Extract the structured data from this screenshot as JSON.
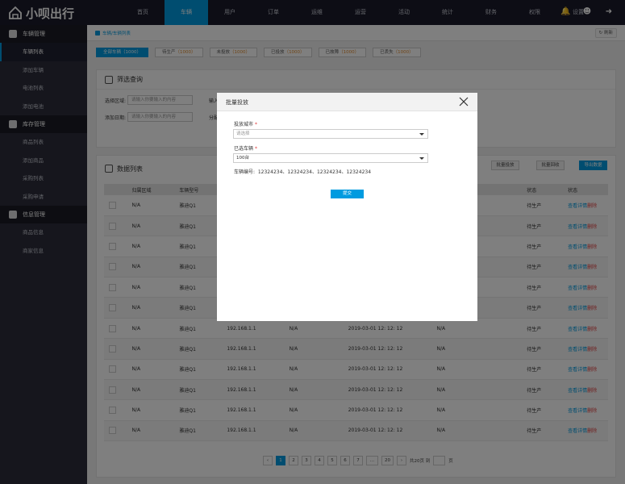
{
  "app": {
    "name": "小呗出行"
  },
  "nav": [
    "首页",
    "车辆",
    "用户",
    "订单",
    "运维",
    "运营",
    "活动",
    "统计",
    "财务",
    "权限",
    "设置"
  ],
  "nav_active": 1,
  "sidebar": {
    "groups": [
      {
        "label": "车辆管理",
        "icon": "scooter-icon",
        "items": [
          "车辆列表",
          "添加车辆",
          "电池列表",
          "添加电池"
        ]
      },
      {
        "label": "库存管理",
        "icon": "inventory-icon",
        "items": [
          "商品列表",
          "添加商品",
          "采购列表",
          "采购申请"
        ]
      },
      {
        "label": "信息管理",
        "icon": "layers-icon",
        "items": [
          "商品信息",
          "商家信息"
        ]
      }
    ],
    "active": "车辆列表"
  },
  "breadcrumb": "车辆/车辆列表",
  "refresh_label": "刷新",
  "status_tabs": [
    {
      "label": "全部车辆",
      "count": "（1000）"
    },
    {
      "label": "待生产",
      "count": "（1000）"
    },
    {
      "label": "未投放",
      "count": "（1000）"
    },
    {
      "label": "已投放",
      "count": "（1000）"
    },
    {
      "label": "已故障",
      "count": "（1000）"
    },
    {
      "label": "已丢失",
      "count": "（1000）"
    }
  ],
  "filter": {
    "title": "筛选查询",
    "region_label": "选择区域:",
    "region_placeholder": "请输入你要输入的内容",
    "date_label": "添加日期:",
    "date_placeholder": "请输入你要输入的内容",
    "input_label": "输入",
    "dist_label": "分配"
  },
  "list": {
    "title": "数据列表",
    "btn_batch_deploy": "批量投放",
    "btn_batch_recall": "批量回收",
    "btn_export": "导出数据",
    "headers": [
      "",
      "归属区域",
      "车辆型号",
      "",
      "",
      "",
      "",
      "状态",
      "状态"
    ],
    "rows": [
      [
        "N/A",
        "雅迪Q1",
        "",
        "",
        "",
        "",
        "待生产"
      ],
      [
        "N/A",
        "雅迪Q1",
        "",
        "",
        "",
        "",
        "待生产"
      ],
      [
        "N/A",
        "雅迪Q1",
        "",
        "",
        "",
        "",
        "待生产"
      ],
      [
        "N/A",
        "雅迪Q1",
        "",
        "",
        "",
        "",
        "待生产"
      ],
      [
        "N/A",
        "雅迪Q1",
        "",
        "",
        "",
        "",
        "待生产"
      ],
      [
        "N/A",
        "雅迪Q1",
        "",
        "",
        "",
        "",
        "待生产"
      ],
      [
        "N/A",
        "雅迪Q1",
        "192.168.1.1",
        "N/A",
        "2019-03-01 12:  12:  12",
        "N/A",
        "待生产"
      ],
      [
        "N/A",
        "雅迪Q1",
        "192.168.1.1",
        "N/A",
        "2019-03-01 12:  12:  12",
        "N/A",
        "待生产"
      ],
      [
        "N/A",
        "雅迪Q1",
        "192.168.1.1",
        "N/A",
        "2019-03-01 12:  12:  12",
        "N/A",
        "待生产"
      ],
      [
        "N/A",
        "雅迪Q1",
        "192.168.1.1",
        "N/A",
        "2019-03-01 12:  12:  12",
        "N/A",
        "待生产"
      ],
      [
        "N/A",
        "雅迪Q1",
        "192.168.1.1",
        "N/A",
        "2019-03-01 12:  12:  12",
        "N/A",
        "待生产"
      ],
      [
        "N/A",
        "雅迪Q1",
        "192.168.1.1",
        "N/A",
        "2019-03-01 12:  12:  12",
        "N/A",
        "待生产"
      ]
    ],
    "action_view": "查看详情",
    "action_delete": "删除"
  },
  "pager": {
    "prev": "‹",
    "pages": [
      "1",
      "2",
      "3",
      "4",
      "5",
      "6",
      "7",
      "...",
      "20"
    ],
    "next": "›",
    "total": "共20页 到",
    "page_suffix": "页",
    "current": "1"
  },
  "modal": {
    "title": "批量投放",
    "city_label": "投放城市",
    "city_placeholder": "请选择",
    "selected_label": "已选车辆",
    "selected_value": "100台",
    "ids_label": "车辆编号:",
    "ids_value": "12324234、12324234、12324234、12324234",
    "required_mark": "*",
    "submit_label": "提交"
  },
  "colors": {
    "accent": "#009be0",
    "topbar": "#1a1b2a",
    "sidebar": "#2c2d3a",
    "danger": "#e03c3c"
  }
}
